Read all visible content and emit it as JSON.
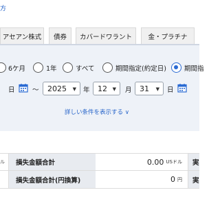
{
  "top_link": "方",
  "tabs": [
    "アセアン株式",
    "債券",
    "カバードワラント",
    "金・プラチナ"
  ],
  "period": {
    "options": [
      "6ケ月",
      "1年",
      "すべて",
      "期間指定(約定日)",
      "期間指"
    ],
    "selected": "期間指"
  },
  "date_range": {
    "start_day_suffix": "日",
    "separator": "～",
    "end_year": "2025",
    "year_suffix": "年",
    "end_month": "12",
    "month_suffix": "月",
    "end_day": "31",
    "day_suffix": "日"
  },
  "detail_link": "詳しい条件を表示する ∨",
  "summary": [
    {
      "unit_fragment": "ル",
      "label": "損失金額合計",
      "value": "0.00",
      "unit": "USドル",
      "tail": "実"
    },
    {
      "unit_fragment": "",
      "label": "損失金額合計(円換算)",
      "value": "0",
      "unit": "円",
      "tail": "実"
    }
  ],
  "colors": {
    "accent": "#2a6ad3",
    "link": "#2563c9",
    "panel_bg": "#eef2f8",
    "header_bg": "#e8ebf0"
  }
}
